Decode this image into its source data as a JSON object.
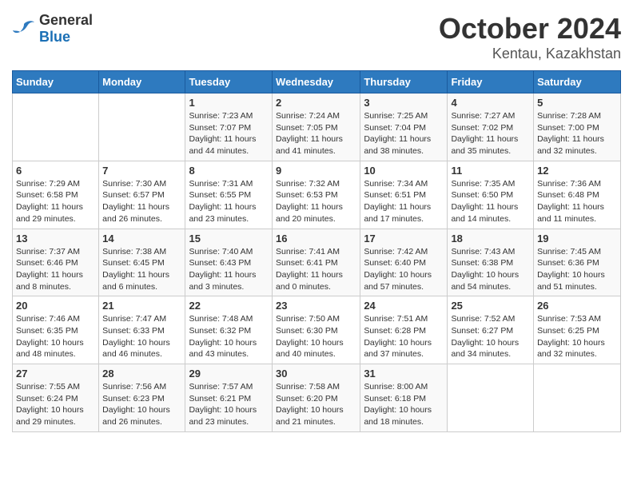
{
  "header": {
    "logo_general": "General",
    "logo_blue": "Blue",
    "month": "October 2024",
    "location": "Kentau, Kazakhstan"
  },
  "days_of_week": [
    "Sunday",
    "Monday",
    "Tuesday",
    "Wednesday",
    "Thursday",
    "Friday",
    "Saturday"
  ],
  "weeks": [
    [
      {
        "day": "",
        "info": ""
      },
      {
        "day": "",
        "info": ""
      },
      {
        "day": "1",
        "info": "Sunrise: 7:23 AM\nSunset: 7:07 PM\nDaylight: 11 hours and 44 minutes."
      },
      {
        "day": "2",
        "info": "Sunrise: 7:24 AM\nSunset: 7:05 PM\nDaylight: 11 hours and 41 minutes."
      },
      {
        "day": "3",
        "info": "Sunrise: 7:25 AM\nSunset: 7:04 PM\nDaylight: 11 hours and 38 minutes."
      },
      {
        "day": "4",
        "info": "Sunrise: 7:27 AM\nSunset: 7:02 PM\nDaylight: 11 hours and 35 minutes."
      },
      {
        "day": "5",
        "info": "Sunrise: 7:28 AM\nSunset: 7:00 PM\nDaylight: 11 hours and 32 minutes."
      }
    ],
    [
      {
        "day": "6",
        "info": "Sunrise: 7:29 AM\nSunset: 6:58 PM\nDaylight: 11 hours and 29 minutes."
      },
      {
        "day": "7",
        "info": "Sunrise: 7:30 AM\nSunset: 6:57 PM\nDaylight: 11 hours and 26 minutes."
      },
      {
        "day": "8",
        "info": "Sunrise: 7:31 AM\nSunset: 6:55 PM\nDaylight: 11 hours and 23 minutes."
      },
      {
        "day": "9",
        "info": "Sunrise: 7:32 AM\nSunset: 6:53 PM\nDaylight: 11 hours and 20 minutes."
      },
      {
        "day": "10",
        "info": "Sunrise: 7:34 AM\nSunset: 6:51 PM\nDaylight: 11 hours and 17 minutes."
      },
      {
        "day": "11",
        "info": "Sunrise: 7:35 AM\nSunset: 6:50 PM\nDaylight: 11 hours and 14 minutes."
      },
      {
        "day": "12",
        "info": "Sunrise: 7:36 AM\nSunset: 6:48 PM\nDaylight: 11 hours and 11 minutes."
      }
    ],
    [
      {
        "day": "13",
        "info": "Sunrise: 7:37 AM\nSunset: 6:46 PM\nDaylight: 11 hours and 8 minutes."
      },
      {
        "day": "14",
        "info": "Sunrise: 7:38 AM\nSunset: 6:45 PM\nDaylight: 11 hours and 6 minutes."
      },
      {
        "day": "15",
        "info": "Sunrise: 7:40 AM\nSunset: 6:43 PM\nDaylight: 11 hours and 3 minutes."
      },
      {
        "day": "16",
        "info": "Sunrise: 7:41 AM\nSunset: 6:41 PM\nDaylight: 11 hours and 0 minutes."
      },
      {
        "day": "17",
        "info": "Sunrise: 7:42 AM\nSunset: 6:40 PM\nDaylight: 10 hours and 57 minutes."
      },
      {
        "day": "18",
        "info": "Sunrise: 7:43 AM\nSunset: 6:38 PM\nDaylight: 10 hours and 54 minutes."
      },
      {
        "day": "19",
        "info": "Sunrise: 7:45 AM\nSunset: 6:36 PM\nDaylight: 10 hours and 51 minutes."
      }
    ],
    [
      {
        "day": "20",
        "info": "Sunrise: 7:46 AM\nSunset: 6:35 PM\nDaylight: 10 hours and 48 minutes."
      },
      {
        "day": "21",
        "info": "Sunrise: 7:47 AM\nSunset: 6:33 PM\nDaylight: 10 hours and 46 minutes."
      },
      {
        "day": "22",
        "info": "Sunrise: 7:48 AM\nSunset: 6:32 PM\nDaylight: 10 hours and 43 minutes."
      },
      {
        "day": "23",
        "info": "Sunrise: 7:50 AM\nSunset: 6:30 PM\nDaylight: 10 hours and 40 minutes."
      },
      {
        "day": "24",
        "info": "Sunrise: 7:51 AM\nSunset: 6:28 PM\nDaylight: 10 hours and 37 minutes."
      },
      {
        "day": "25",
        "info": "Sunrise: 7:52 AM\nSunset: 6:27 PM\nDaylight: 10 hours and 34 minutes."
      },
      {
        "day": "26",
        "info": "Sunrise: 7:53 AM\nSunset: 6:25 PM\nDaylight: 10 hours and 32 minutes."
      }
    ],
    [
      {
        "day": "27",
        "info": "Sunrise: 7:55 AM\nSunset: 6:24 PM\nDaylight: 10 hours and 29 minutes."
      },
      {
        "day": "28",
        "info": "Sunrise: 7:56 AM\nSunset: 6:23 PM\nDaylight: 10 hours and 26 minutes."
      },
      {
        "day": "29",
        "info": "Sunrise: 7:57 AM\nSunset: 6:21 PM\nDaylight: 10 hours and 23 minutes."
      },
      {
        "day": "30",
        "info": "Sunrise: 7:58 AM\nSunset: 6:20 PM\nDaylight: 10 hours and 21 minutes."
      },
      {
        "day": "31",
        "info": "Sunrise: 8:00 AM\nSunset: 6:18 PM\nDaylight: 10 hours and 18 minutes."
      },
      {
        "day": "",
        "info": ""
      },
      {
        "day": "",
        "info": ""
      }
    ]
  ]
}
